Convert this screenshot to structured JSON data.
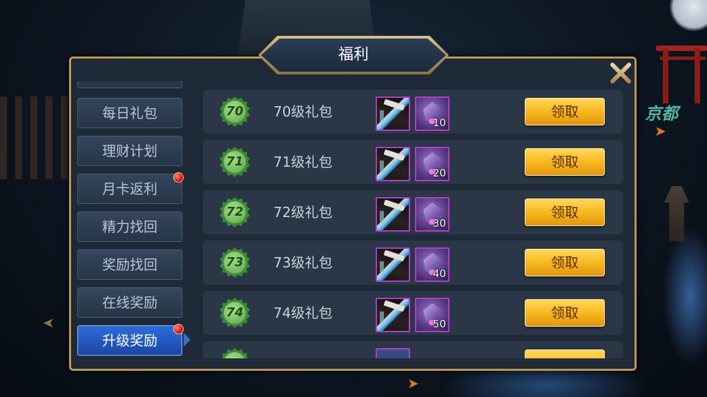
{
  "panel": {
    "title": "福利"
  },
  "background": {
    "location_label": "京都"
  },
  "tabs": [
    {
      "label": "每日礼包",
      "active": false,
      "notify": false
    },
    {
      "label": "理财计划",
      "active": false,
      "notify": false
    },
    {
      "label": "月卡返利",
      "active": false,
      "notify": true
    },
    {
      "label": "精力找回",
      "active": false,
      "notify": false
    },
    {
      "label": "奖励找回",
      "active": false,
      "notify": false
    },
    {
      "label": "在线奖励",
      "active": false,
      "notify": false
    },
    {
      "label": "升级奖励",
      "active": true,
      "notify": true
    }
  ],
  "rewards": [
    {
      "level": "70",
      "label": "70级礼包",
      "crystal_qty": "10",
      "claim_label": "领取"
    },
    {
      "level": "71",
      "label": "71级礼包",
      "crystal_qty": "20",
      "claim_label": "领取"
    },
    {
      "level": "72",
      "label": "72级礼包",
      "crystal_qty": "30",
      "claim_label": "领取"
    },
    {
      "level": "73",
      "label": "73级礼包",
      "crystal_qty": "40",
      "claim_label": "领取"
    },
    {
      "level": "74",
      "label": "74级礼包",
      "crystal_qty": "50",
      "claim_label": "领取"
    }
  ],
  "icons": {
    "close": "close-x-icon",
    "level_badge": "level-seal-icon",
    "item_weapon": "sword-item-icon",
    "item_crystal": "crystal-item-icon",
    "notify": "red-dot-icon"
  },
  "colors": {
    "claim_button": "#f6b51b",
    "active_tab": "#2f6cd8",
    "panel_border": "#b69a66",
    "level_badge": "#3d8a37"
  }
}
